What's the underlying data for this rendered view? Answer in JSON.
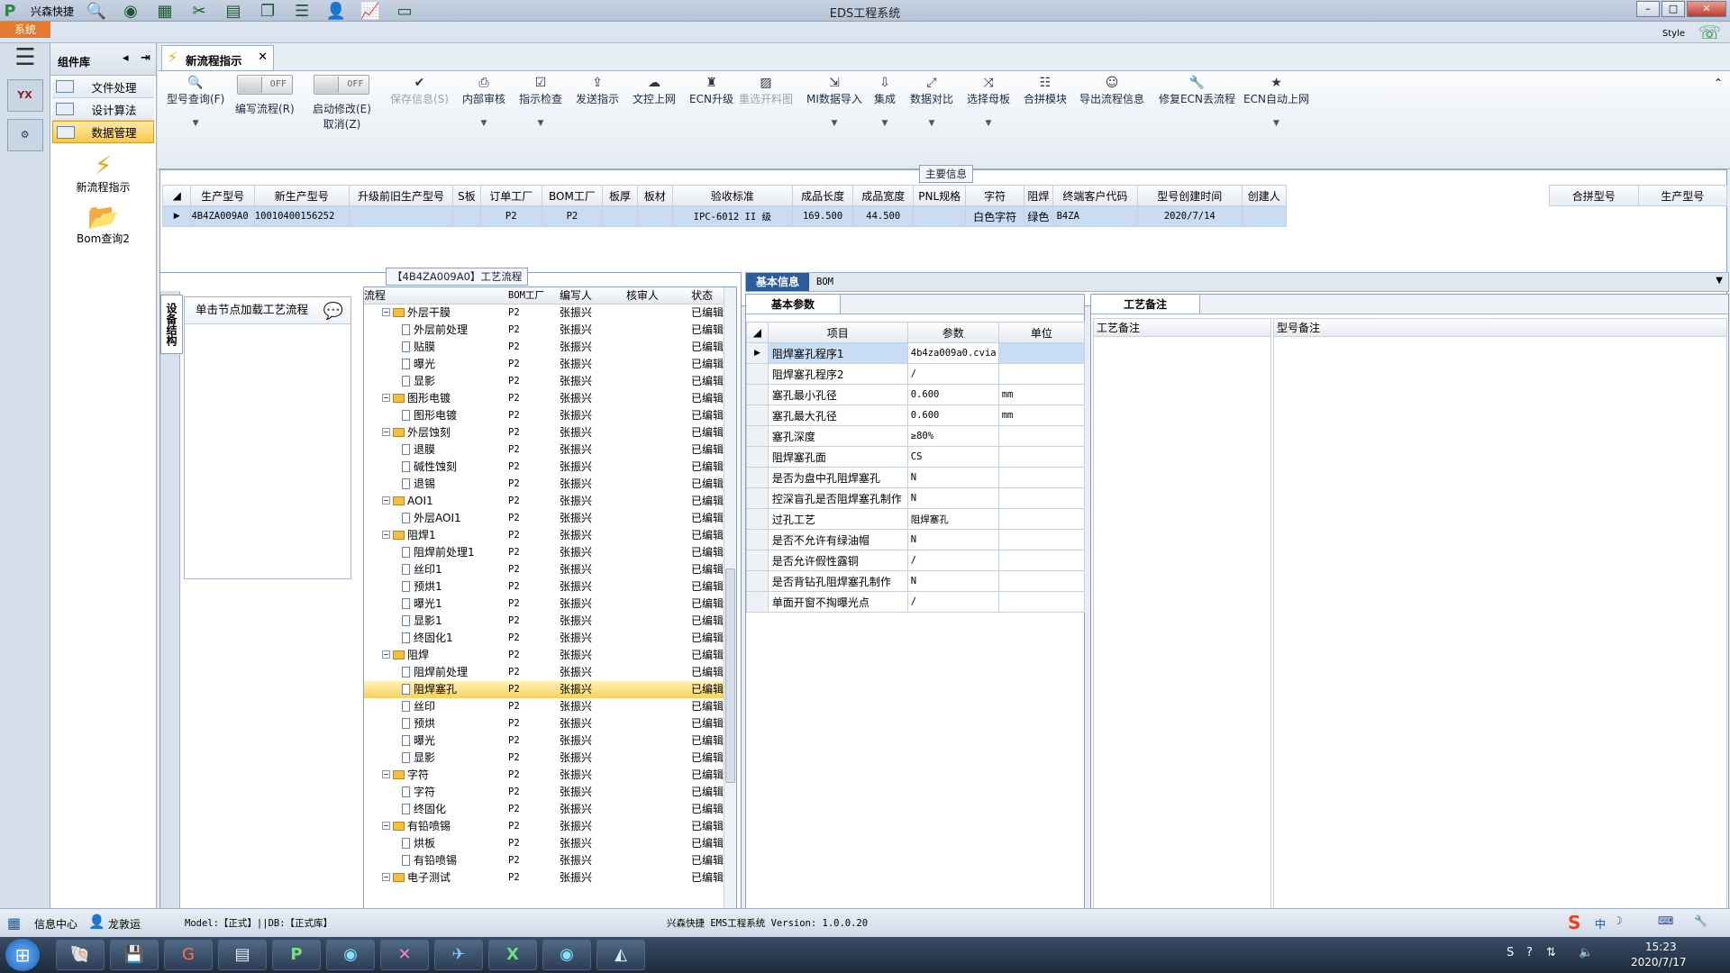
{
  "window": {
    "title": "EDS工程系统",
    "style_label": "Style"
  },
  "quickbar": {
    "brand": "兴森快捷"
  },
  "systab": "系统",
  "sidebar": {
    "header": "组件库",
    "items": [
      {
        "label": "文件处理"
      },
      {
        "label": "设计算法"
      },
      {
        "label": "数据管理"
      }
    ],
    "big_items": [
      {
        "label": "新流程指示"
      },
      {
        "label": "Bom查询2"
      }
    ]
  },
  "tab": {
    "label": "新流程指示"
  },
  "toolbar": {
    "model_query": "型号查询(F)",
    "edit_flow": "编写流程(R)",
    "start_modify": "启动修改(E)",
    "cancel": "取消(Z)",
    "toggle_off": "OFF",
    "buttons": [
      "保存信息(S)",
      "内部审核",
      "指示检查",
      "发送指示",
      "文控上网",
      "ECN升级",
      "重选开料图",
      "MI数据导入",
      "集成",
      "数据对比",
      "选择母板",
      "合拼模块",
      "导出流程信息",
      "修复ECN丢流程",
      "ECN自动上网"
    ]
  },
  "main_info": {
    "caption": "主要信息",
    "columns": [
      "生产型号",
      "新生产型号",
      "升级前旧生产型号",
      "S板",
      "订单工厂",
      "BOM工厂",
      "板厚",
      "板材",
      "验收标准",
      "成品长度",
      "成品宽度",
      "PNL规格",
      "字符",
      "阻焊",
      "终端客户代码",
      "型号创建时间",
      "创建人"
    ],
    "row": [
      "4B4ZA009A0",
      "10010400156252",
      "",
      "",
      "P2",
      "P2",
      "",
      "",
      "IPC-6012 II 级",
      "169.500",
      "44.500",
      "",
      "白色字符",
      "绿色",
      "B4ZA",
      "2020/7/14",
      ""
    ],
    "side_columns": [
      "合拼型号",
      "生产型号"
    ]
  },
  "flow": {
    "caption": "【4B4ZA009A0】工艺流程",
    "vertical_tab": "设备结构",
    "load_hint": "单击节点加载工艺流程",
    "columns": [
      "流程",
      "BOM工厂",
      "编写人",
      "核审人",
      "状态"
    ],
    "rows": [
      {
        "name": "外层干膜",
        "level": 1,
        "type": "folder",
        "factory": "P2",
        "writer": "张振兴",
        "status": "已编辑"
      },
      {
        "name": "外层前处理",
        "level": 2,
        "type": "doc",
        "factory": "P2",
        "writer": "张振兴",
        "status": "已编辑"
      },
      {
        "name": "贴膜",
        "level": 2,
        "type": "doc",
        "factory": "P2",
        "writer": "张振兴",
        "status": "已编辑"
      },
      {
        "name": "曝光",
        "level": 2,
        "type": "doc",
        "factory": "P2",
        "writer": "张振兴",
        "status": "已编辑"
      },
      {
        "name": "显影",
        "level": 2,
        "type": "doc",
        "factory": "P2",
        "writer": "张振兴",
        "status": "已编辑"
      },
      {
        "name": "图形电镀",
        "level": 1,
        "type": "folder",
        "factory": "P2",
        "writer": "张振兴",
        "status": "已编辑"
      },
      {
        "name": "图形电镀",
        "level": 2,
        "type": "doc",
        "factory": "P2",
        "writer": "张振兴",
        "status": "已编辑"
      },
      {
        "name": "外层蚀刻",
        "level": 1,
        "type": "folder",
        "factory": "P2",
        "writer": "张振兴",
        "status": "已编辑"
      },
      {
        "name": "退膜",
        "level": 2,
        "type": "doc",
        "factory": "P2",
        "writer": "张振兴",
        "status": "已编辑"
      },
      {
        "name": "碱性蚀刻",
        "level": 2,
        "type": "doc",
        "factory": "P2",
        "writer": "张振兴",
        "status": "已编辑"
      },
      {
        "name": "退锡",
        "level": 2,
        "type": "doc",
        "factory": "P2",
        "writer": "张振兴",
        "status": "已编辑"
      },
      {
        "name": "AOI1",
        "level": 1,
        "type": "folder",
        "factory": "P2",
        "writer": "张振兴",
        "status": "已编辑"
      },
      {
        "name": "外层AOI1",
        "level": 2,
        "type": "doc",
        "factory": "P2",
        "writer": "张振兴",
        "status": "已编辑"
      },
      {
        "name": "阻焊1",
        "level": 1,
        "type": "folder",
        "factory": "P2",
        "writer": "张振兴",
        "status": "已编辑"
      },
      {
        "name": "阻焊前处理1",
        "level": 2,
        "type": "doc",
        "factory": "P2",
        "writer": "张振兴",
        "status": "已编辑"
      },
      {
        "name": "丝印1",
        "level": 2,
        "type": "doc",
        "factory": "P2",
        "writer": "张振兴",
        "status": "已编辑"
      },
      {
        "name": "预烘1",
        "level": 2,
        "type": "doc",
        "factory": "P2",
        "writer": "张振兴",
        "status": "已编辑"
      },
      {
        "name": "曝光1",
        "level": 2,
        "type": "doc",
        "factory": "P2",
        "writer": "张振兴",
        "status": "已编辑"
      },
      {
        "name": "显影1",
        "level": 2,
        "type": "doc",
        "factory": "P2",
        "writer": "张振兴",
        "status": "已编辑"
      },
      {
        "name": "终固化1",
        "level": 2,
        "type": "doc",
        "factory": "P2",
        "writer": "张振兴",
        "status": "已编辑"
      },
      {
        "name": "阻焊",
        "level": 1,
        "type": "folder",
        "factory": "P2",
        "writer": "张振兴",
        "status": "已编辑"
      },
      {
        "name": "阻焊前处理",
        "level": 2,
        "type": "doc",
        "factory": "P2",
        "writer": "张振兴",
        "status": "已编辑"
      },
      {
        "name": "阻焊塞孔",
        "level": 2,
        "type": "doc",
        "factory": "P2",
        "writer": "张振兴",
        "status": "已编辑",
        "selected": true
      },
      {
        "name": "丝印",
        "level": 2,
        "type": "doc",
        "factory": "P2",
        "writer": "张振兴",
        "status": "已编辑"
      },
      {
        "name": "预烘",
        "level": 2,
        "type": "doc",
        "factory": "P2",
        "writer": "张振兴",
        "status": "已编辑"
      },
      {
        "name": "曝光",
        "level": 2,
        "type": "doc",
        "factory": "P2",
        "writer": "张振兴",
        "status": "已编辑"
      },
      {
        "name": "显影",
        "level": 2,
        "type": "doc",
        "factory": "P2",
        "writer": "张振兴",
        "status": "已编辑"
      },
      {
        "name": "字符",
        "level": 1,
        "type": "folder",
        "factory": "P2",
        "writer": "张振兴",
        "status": "已编辑"
      },
      {
        "name": "字符",
        "level": 2,
        "type": "doc",
        "factory": "P2",
        "writer": "张振兴",
        "status": "已编辑"
      },
      {
        "name": "终固化",
        "level": 2,
        "type": "doc",
        "factory": "P2",
        "writer": "张振兴",
        "status": "已编辑"
      },
      {
        "name": "有铅喷锡",
        "level": 1,
        "type": "folder",
        "factory": "P2",
        "writer": "张振兴",
        "status": "已编辑"
      },
      {
        "name": "烘板",
        "level": 2,
        "type": "doc",
        "factory": "P2",
        "writer": "张振兴",
        "status": "已编辑"
      },
      {
        "name": "有铅喷锡",
        "level": 2,
        "type": "doc",
        "factory": "P2",
        "writer": "张振兴",
        "status": "已编辑"
      },
      {
        "name": "电子测试",
        "level": 1,
        "type": "folder",
        "factory": "P2",
        "writer": "张振兴",
        "status": "已编辑"
      }
    ]
  },
  "info_tabs": [
    "基本信息",
    "BOM"
  ],
  "params": {
    "tab": "基本参数",
    "columns": [
      "项目",
      "参数",
      "单位"
    ],
    "rows": [
      {
        "item": "阻焊塞孔程序1",
        "value": "4b4za009a0.cvia",
        "unit": ""
      },
      {
        "item": "阻焊塞孔程序2",
        "value": "/",
        "unit": ""
      },
      {
        "item": "塞孔最小孔径",
        "value": "0.600",
        "unit": "mm"
      },
      {
        "item": "塞孔最大孔径",
        "value": "0.600",
        "unit": "mm"
      },
      {
        "item": "塞孔深度",
        "value": "≥80%",
        "unit": ""
      },
      {
        "item": "阻焊塞孔面",
        "value": "CS",
        "unit": ""
      },
      {
        "item": "是否为盘中孔阻焊塞孔",
        "value": "N",
        "unit": ""
      },
      {
        "item": "控深盲孔是否阻焊塞孔制作",
        "value": "N",
        "unit": ""
      },
      {
        "item": "过孔工艺",
        "value": "阻焊塞孔",
        "unit": ""
      },
      {
        "item": "是否不允许有绿油帽",
        "value": "N",
        "unit": ""
      },
      {
        "item": "是否允许假性露铜",
        "value": "/",
        "unit": ""
      },
      {
        "item": "是否背钻孔阻焊塞孔制作",
        "value": "N",
        "unit": ""
      },
      {
        "item": "单面开窗不掏曝光点",
        "value": "/",
        "unit": ""
      }
    ]
  },
  "remarks": {
    "tab": "工艺备注",
    "columns": [
      "工艺备注",
      "型号备注"
    ]
  },
  "status": {
    "info_center": "信息中心",
    "user": "龙敦运",
    "model": "Model:【正式】||DB:【正式库】",
    "version": "兴森快捷 EMS工程系统 Version: 1.0.0.20"
  },
  "taskbar": {
    "time": "15:23",
    "date": "2020/7/17",
    "ime": "中"
  }
}
